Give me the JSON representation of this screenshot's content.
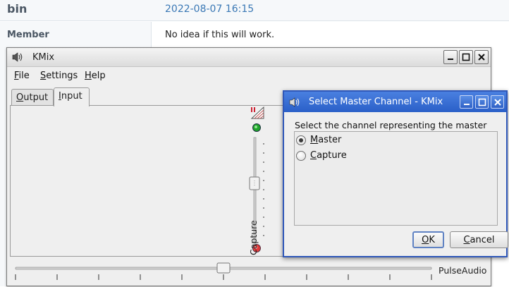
{
  "forum": {
    "username": "bin",
    "post_date": "2022-08-07 16:15",
    "role": "Member",
    "post_text": "No idea if this will work."
  },
  "kmix": {
    "title": "KMix",
    "icon": "speaker-icon",
    "menu": [
      {
        "label": "File",
        "accel": "F",
        "rest": "ile"
      },
      {
        "label": "Settings",
        "accel": "S",
        "rest": "ettings"
      },
      {
        "label": "Help",
        "accel": "H",
        "rest": "elp"
      }
    ],
    "tabs": [
      {
        "label": "Output",
        "accel": "O",
        "rest": "utput",
        "active": false
      },
      {
        "label": "Input",
        "accel": "I",
        "rest": "nput",
        "active": true
      }
    ],
    "channel": {
      "label": "Capture",
      "capture_led": "green",
      "mute_led": "red"
    },
    "backend_label": "PulseAudio",
    "balance_level": 0.5
  },
  "dialog": {
    "title": "Select Master Channel - KMix",
    "prompt": "Select the channel representing the master volume:",
    "options": [
      {
        "label": "Master",
        "accel": "M",
        "rest": "aster",
        "checked": true
      },
      {
        "label": "Capture",
        "accel": "C",
        "rest": "apture",
        "checked": false
      }
    ],
    "ok": {
      "accel": "O",
      "rest": "K"
    },
    "cancel": {
      "accel": "C",
      "rest": "ancel"
    }
  },
  "colors": {
    "dialog_titlebar": "#2a5fc8",
    "led_green": "#1fa52b",
    "led_red": "#e23a3a",
    "forum_link": "#3a78b5"
  }
}
